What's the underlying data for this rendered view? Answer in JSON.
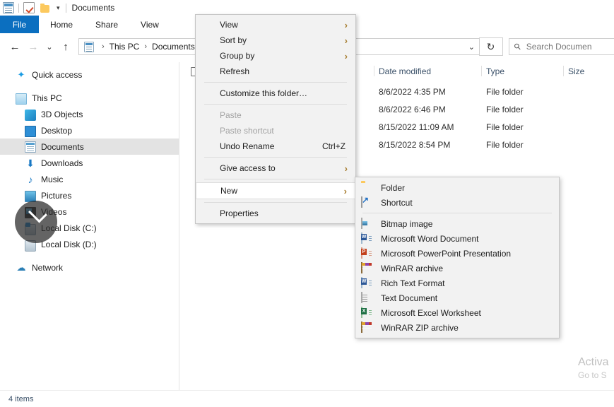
{
  "window": {
    "title": "Documents",
    "titlebar_icons": [
      "explorer-icon",
      "checkbox-red-check-icon",
      "folder-icon",
      "dropdown-chevron-icon"
    ]
  },
  "ribbon": {
    "tabs": [
      {
        "label": "File",
        "active": true
      },
      {
        "label": "Home",
        "active": false
      },
      {
        "label": "Share",
        "active": false
      },
      {
        "label": "View",
        "active": false
      }
    ]
  },
  "nav": {
    "back": "←",
    "forward": "→",
    "recent": "⌄",
    "up": "↑",
    "breadcrumb": [
      "This PC",
      "Documents"
    ],
    "breadcrumb_separator": "›",
    "address_dropdown": "⌄",
    "refresh": "↻",
    "search_placeholder": "Search Documen"
  },
  "sidebar": {
    "items": [
      {
        "label": "Quick access",
        "indent": 0,
        "icon": "star-icon",
        "selected": false
      },
      {
        "label": "This PC",
        "indent": 0,
        "icon": "pc-icon",
        "selected": false
      },
      {
        "label": "3D Objects",
        "indent": 1,
        "icon": "3d-objects-icon",
        "selected": false
      },
      {
        "label": "Desktop",
        "indent": 1,
        "icon": "desktop-icon",
        "selected": false
      },
      {
        "label": "Documents",
        "indent": 1,
        "icon": "documents-icon",
        "selected": true
      },
      {
        "label": "Downloads",
        "indent": 1,
        "icon": "downloads-icon",
        "selected": false
      },
      {
        "label": "Music",
        "indent": 1,
        "icon": "music-icon",
        "selected": false
      },
      {
        "label": "Pictures",
        "indent": 1,
        "icon": "pictures-icon",
        "selected": false
      },
      {
        "label": "Videos",
        "indent": 1,
        "icon": "videos-icon",
        "selected": false
      },
      {
        "label": "Local Disk (C:)",
        "indent": 1,
        "icon": "disk-c-icon",
        "selected": false
      },
      {
        "label": "Local Disk (D:)",
        "indent": 1,
        "icon": "disk-d-icon",
        "selected": false
      },
      {
        "label": "Network",
        "indent": 0,
        "icon": "network-icon",
        "selected": false
      }
    ]
  },
  "filelist": {
    "columns": [
      "Date modified",
      "Type",
      "Size"
    ],
    "rows": [
      {
        "date": "8/6/2022 4:35 PM",
        "type": "File folder",
        "size": ""
      },
      {
        "date": "8/6/2022 6:46 PM",
        "type": "File folder",
        "size": ""
      },
      {
        "date": "8/15/2022 11:09 AM",
        "type": "File folder",
        "size": ""
      },
      {
        "date": "8/15/2022 8:54 PM",
        "type": "File folder",
        "size": ""
      }
    ]
  },
  "statusbar": {
    "item_count": "4 items"
  },
  "watermark": {
    "line1": "Activa",
    "line2": "Go to S"
  },
  "context_menu": {
    "items": [
      {
        "label": "View",
        "type": "submenu",
        "disabled": false,
        "accel": "",
        "highlighted": false
      },
      {
        "label": "Sort by",
        "type": "submenu",
        "disabled": false,
        "accel": "",
        "highlighted": false
      },
      {
        "label": "Group by",
        "type": "submenu",
        "disabled": false,
        "accel": "",
        "highlighted": false
      },
      {
        "label": "Refresh",
        "type": "action",
        "disabled": false,
        "accel": "",
        "highlighted": false
      },
      {
        "type": "separator"
      },
      {
        "label": "Customize this folder…",
        "type": "action",
        "disabled": false,
        "accel": "",
        "highlighted": false
      },
      {
        "type": "separator"
      },
      {
        "label": "Paste",
        "type": "action",
        "disabled": true,
        "accel": "",
        "highlighted": false
      },
      {
        "label": "Paste shortcut",
        "type": "action",
        "disabled": true,
        "accel": "",
        "highlighted": false
      },
      {
        "label": "Undo Rename",
        "type": "action",
        "disabled": false,
        "accel": "Ctrl+Z",
        "highlighted": false
      },
      {
        "type": "separator"
      },
      {
        "label": "Give access to",
        "type": "submenu",
        "disabled": false,
        "accel": "",
        "highlighted": false
      },
      {
        "type": "separator"
      },
      {
        "label": "New",
        "type": "submenu",
        "disabled": false,
        "accel": "",
        "highlighted": true
      },
      {
        "type": "separator"
      },
      {
        "label": "Properties",
        "type": "action",
        "disabled": false,
        "accel": "",
        "highlighted": false
      }
    ],
    "submenu_arrow": "›"
  },
  "new_submenu": {
    "items": [
      {
        "label": "Folder",
        "icon": "folder-icon"
      },
      {
        "label": "Shortcut",
        "icon": "shortcut-icon"
      },
      {
        "type": "separator"
      },
      {
        "label": "Bitmap image",
        "icon": "bitmap-image-icon"
      },
      {
        "label": "Microsoft Word Document",
        "icon": "word-document-icon"
      },
      {
        "label": "Microsoft PowerPoint Presentation",
        "icon": "powerpoint-icon"
      },
      {
        "label": "WinRAR archive",
        "icon": "winrar-icon"
      },
      {
        "label": "Rich Text Format",
        "icon": "rich-text-icon"
      },
      {
        "label": "Text Document",
        "icon": "text-document-icon"
      },
      {
        "label": "Microsoft Excel Worksheet",
        "icon": "excel-icon"
      },
      {
        "label": "WinRAR ZIP archive",
        "icon": "winrar-zip-icon"
      }
    ]
  },
  "colors": {
    "accent": "#0b6fc0",
    "menu_bg": "#f2f2f2",
    "selection": "#e3e3e3",
    "column_header_text": "#3a5068"
  }
}
